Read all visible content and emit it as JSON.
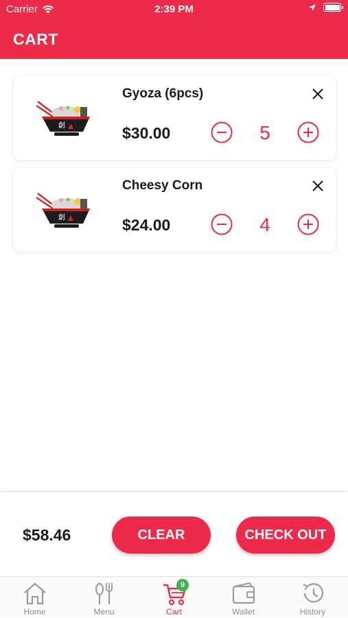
{
  "status_bar": {
    "carrier": "Carrier",
    "time": "2:39 PM"
  },
  "header": {
    "title": "CART"
  },
  "cart": {
    "items": [
      {
        "name": "Gyoza (6pcs)",
        "price": "$30.00",
        "quantity": "5"
      },
      {
        "name": "Cheesy Corn",
        "price": "$24.00",
        "quantity": "4"
      }
    ]
  },
  "summary": {
    "total": "$58.46",
    "clear_label": "CLEAR",
    "checkout_label": "CHECK OUT"
  },
  "tabs": [
    {
      "label": "Home",
      "icon": "home-icon"
    },
    {
      "label": "Menu",
      "icon": "fork-knife-icon"
    },
    {
      "label": "Cart",
      "icon": "cart-icon",
      "badge": "9"
    },
    {
      "label": "Wallet",
      "icon": "wallet-icon"
    },
    {
      "label": "History",
      "icon": "history-icon"
    }
  ],
  "colors": {
    "accent": "#ee2a4a",
    "badge": "#3cb44b",
    "inactive_tab": "#8e8e93"
  }
}
